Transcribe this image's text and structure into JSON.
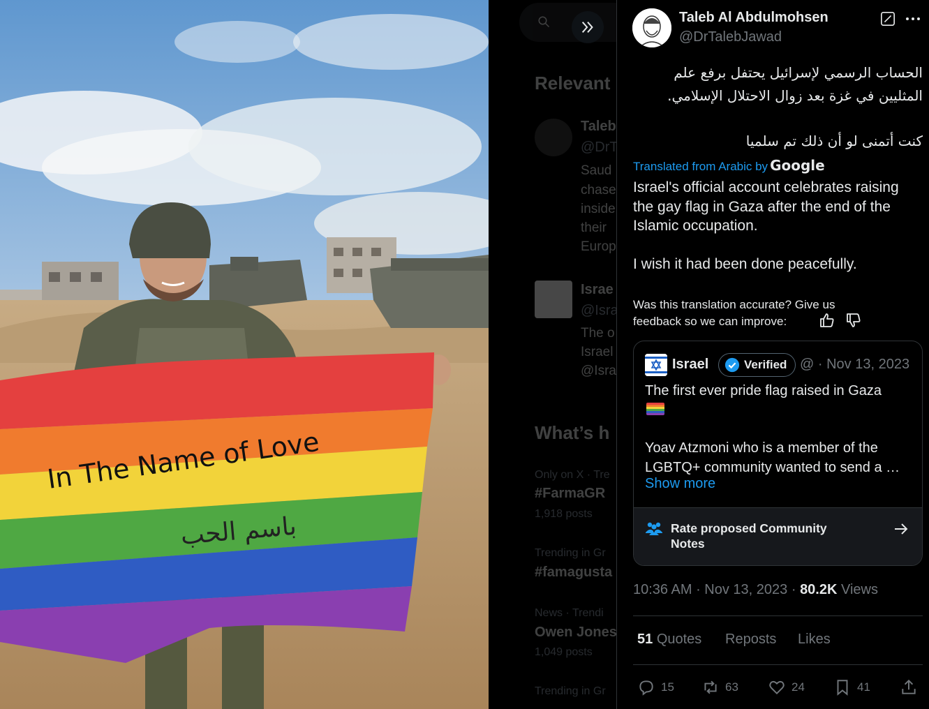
{
  "viewer": {
    "expand_icon": "double-chevron-right-icon",
    "photo_alt_text_flag_line1": "In The Name of Love",
    "photo_alt_text_flag_line2": "باسم الحب"
  },
  "background": {
    "relevant_heading": "Relevant",
    "relevant_user1": {
      "name": "Taleb",
      "handle": "@DrT",
      "lines": [
        "Saud",
        "chase",
        "inside",
        "their",
        "Europ"
      ]
    },
    "relevant_user2": {
      "name": "Israe",
      "handle": "@Isra",
      "lines": [
        "The o",
        "Israel",
        "@Isra"
      ]
    },
    "whats_heading": "What’s h",
    "trends": [
      {
        "context": "Only on X · Tre",
        "name": "#FarmaGR",
        "posts": "1,918 posts"
      },
      {
        "context": "Trending in Gr",
        "name": "#famagusta",
        "posts": ""
      },
      {
        "context": "News · Trendi",
        "name": "Owen Jones",
        "posts": "1,049 posts"
      },
      {
        "context": "Trending in Gr",
        "name": "",
        "posts": ""
      }
    ]
  },
  "tweet": {
    "author_name": "Taleb Al Abdulmohsen",
    "author_handle": "@DrTalebJawad",
    "arabic_paragraph1": "الحساب الرسمي لإسرائيل يحتفل برفع علم المثليين في غزة بعد زوال الاحتلال الإسلامي.",
    "arabic_paragraph2": "كنت أتمنى لو أن ذلك تم سلميا",
    "translated_from": "Translated from Arabic by",
    "translator": "Google",
    "translation_paragraph1": "Israel's official account celebrates raising the gay flag in Gaza after the end of the Islamic occupation.",
    "translation_paragraph2": "I wish it had been done peacefully.",
    "feedback_prompt": "Was this translation accurate? Give us feedback so we can improve:",
    "time": "10:36 AM",
    "date": "Nov 13, 2023",
    "views_count": "80.2K",
    "views_label": "Views",
    "quotes_count": "51",
    "quotes_label": "Quotes",
    "reposts_label": "Reposts",
    "likes_label": "Likes",
    "actions": {
      "replies": "15",
      "reposts": "63",
      "likes": "24",
      "bookmarks": "41"
    }
  },
  "quoted": {
    "name": "Israel",
    "verified_label": "Verified",
    "handle_at": "@",
    "date": "Nov 13, 2023",
    "line1": "The first ever pride flag raised in Gaza",
    "line2": "Yoav Atzmoni who is a member of the",
    "line3": "LGBTQ+ community wanted to send a …",
    "show_more": "Show more",
    "community_notes": "Rate proposed Community Notes"
  },
  "colors": {
    "accent": "#1d9bf0",
    "muted": "#71767b",
    "border": "#2f3336",
    "text": "#e7e9ea"
  }
}
